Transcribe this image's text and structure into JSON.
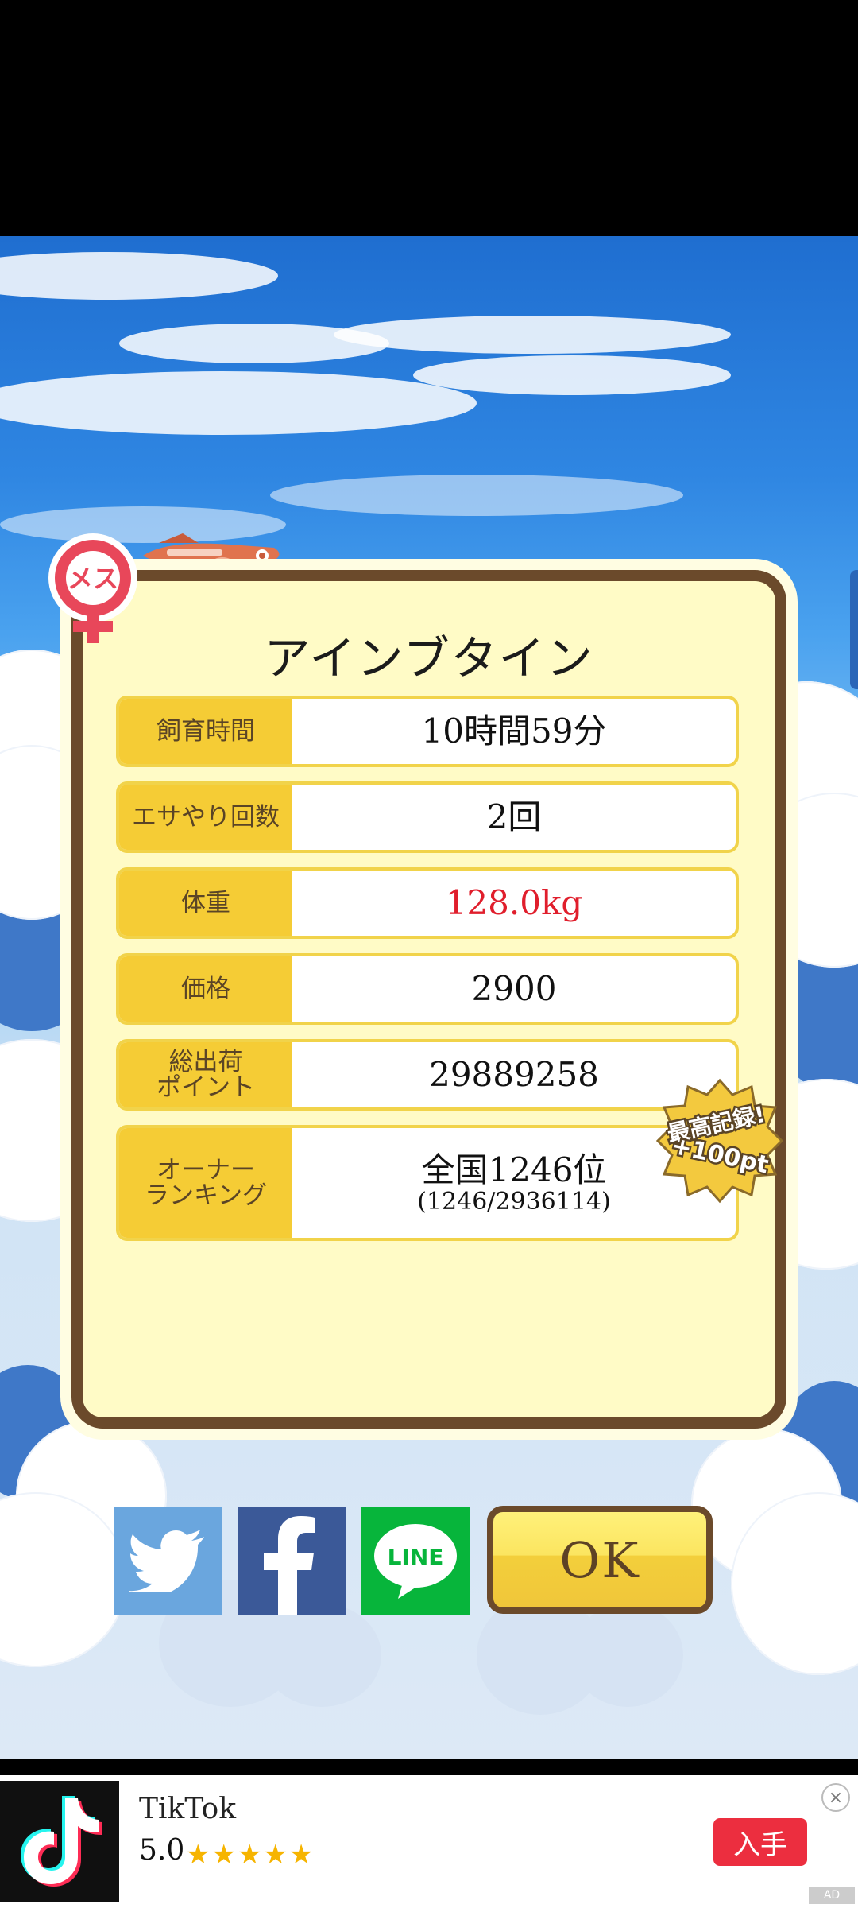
{
  "screen": {
    "title": "アインブタイン"
  },
  "badge": {
    "label": "メス"
  },
  "stats": [
    {
      "label": "飼育時間",
      "value": "10時間59分",
      "sub": "",
      "highlight": false
    },
    {
      "label": "エサやり回数",
      "value": "2回",
      "sub": "",
      "highlight": false
    },
    {
      "label": "体重",
      "value": "128.0kg",
      "sub": "",
      "highlight": true
    },
    {
      "label": "価格",
      "value": "2900",
      "sub": "",
      "highlight": false
    },
    {
      "label": "総出荷\nポイント",
      "value": "29889258",
      "sub": "",
      "highlight": false
    },
    {
      "label": "オーナー\nランキング",
      "value": "全国1246位",
      "sub": "(1246/2936114)",
      "highlight": false
    }
  ],
  "record_badge": {
    "line1": "最高記録!",
    "line2": "+100pt"
  },
  "share": {
    "twitter_icon": "twitter-bird-icon",
    "facebook_icon": "facebook-f-icon",
    "line_label": "LINE"
  },
  "ok_button": {
    "label": "OK"
  },
  "ad": {
    "app_name": "TikTok",
    "rating": "5.0",
    "stars": "★★★★★",
    "cta": "入手",
    "close": "×",
    "tag": "AD"
  },
  "colors": {
    "accent": "#f5cc35",
    "frame": "#6b4a2b",
    "panel": "#fffbc6",
    "highlight": "#e01e2c"
  }
}
